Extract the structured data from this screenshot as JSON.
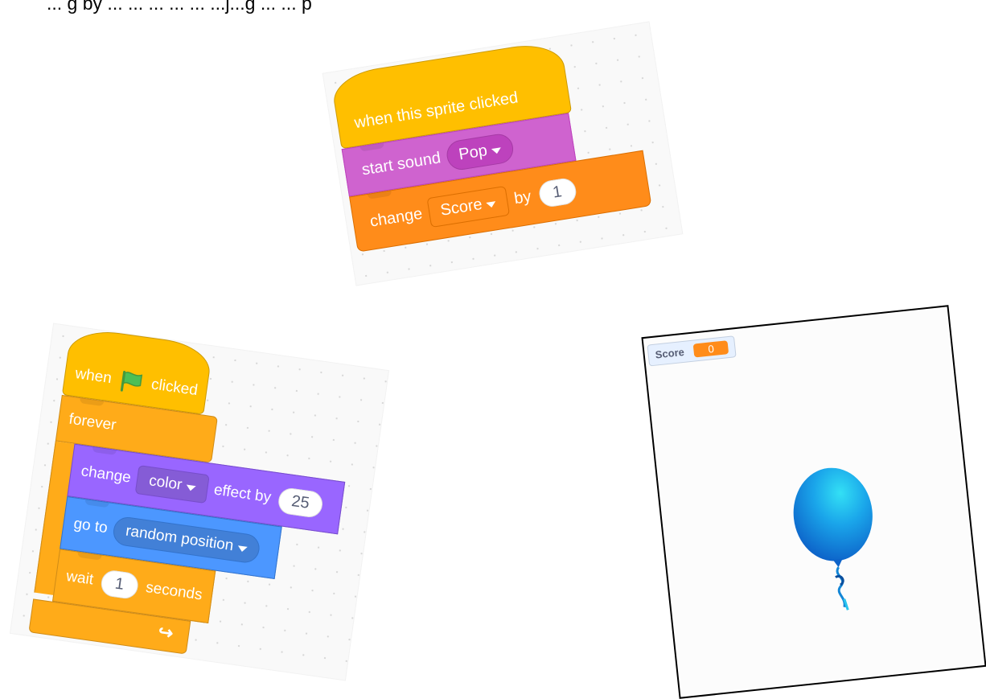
{
  "caption": "... g by ... ... ... ... ... ...j...g ... ... p",
  "sprite_script": {
    "hat_label": "when this sprite clicked",
    "sound_label": "start sound",
    "sound_value": "Pop",
    "var_label": "change",
    "var_name": "Score",
    "var_by": "by",
    "var_amount": "1"
  },
  "flag_script": {
    "hat_when": "when",
    "hat_clicked": "clicked",
    "forever_label": "forever",
    "effect_label": "change",
    "effect_name": "color",
    "effect_by": "effect by",
    "effect_amount": "25",
    "goto_label": "go to",
    "goto_target": "random position",
    "wait_label": "wait",
    "wait_amount": "1",
    "wait_unit": "seconds"
  },
  "stage": {
    "monitor_label": "Score",
    "monitor_value": "0"
  },
  "icons": [
    "green-flag-icon",
    "dropdown-arrow-icon",
    "loop-arrow-icon",
    "balloon-sprite"
  ],
  "colors": {
    "events": "#ffbf00",
    "sound": "#cf63cf",
    "variables": "#ff8c1a",
    "control": "#ffab19",
    "looks": "#9966ff",
    "motion": "#4c97ff",
    "balloon": "#1e9be8"
  }
}
